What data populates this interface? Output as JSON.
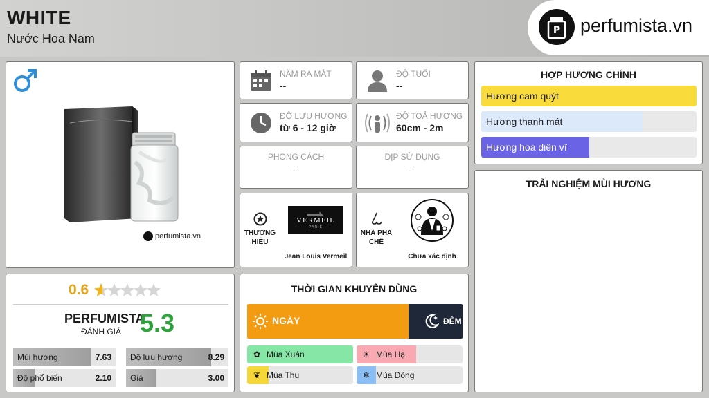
{
  "header": {
    "title": "WHITE",
    "subtitle": "Nước Hoa Nam",
    "logo_text": "perfumista.vn"
  },
  "product": {
    "gender_icon": "male-icon",
    "watermark": "perfumista.vn"
  },
  "info": {
    "release_year": {
      "label": "NĂM RA MẮT",
      "value": "--",
      "icon": "calendar-icon"
    },
    "age": {
      "label": "ĐỘ TUỔI",
      "value": "--",
      "icon": "person-icon"
    },
    "longevity": {
      "label": "ĐỘ LƯU HƯƠNG",
      "value": "từ 6 - 12 giờ",
      "icon": "clock-icon"
    },
    "sillage": {
      "label": "ĐỘ TOẢ HƯƠNG",
      "value": "60cm - 2m",
      "icon": "sillage-icon"
    },
    "style": {
      "label": "PHONG CÁCH",
      "value": "--"
    },
    "occasion": {
      "label": "DỊP SỬ DỤNG",
      "value": "--"
    }
  },
  "brand": {
    "label_line1": "THƯƠNG",
    "label_line2": "HIỆU",
    "name": "Jean Louis Vermeil",
    "logo_text": "VERMEIL",
    "logo_sub": "PARIS"
  },
  "perfumer": {
    "label_line1": "NHÀ PHA",
    "label_line2": "CHẾ",
    "name": "Chưa xác định"
  },
  "accords": {
    "title": "HỢP HƯƠNG CHÍNH",
    "items": [
      {
        "label": "Hương cam quýt",
        "level": 1.0,
        "color": "#f9dc3c"
      },
      {
        "label": "Hương thanh mát",
        "level": 0.75,
        "color": "#dbe9fb"
      },
      {
        "label": "Hương hoa diên vĩ",
        "level": 0.5,
        "color": "#6a63e6"
      }
    ]
  },
  "experience": {
    "title": "TRẢI NGHIỆM MÙI HƯƠNG"
  },
  "rating": {
    "score": "0.6",
    "stars_total": 5,
    "stars_filled": 0.6,
    "brand": "PERFUMISTA",
    "brand_sub": "ĐÁNH GIÁ",
    "overall": "5.3",
    "stats": [
      {
        "label": "Mùi hương",
        "value": "7.63",
        "level": 0.763
      },
      {
        "label": "Độ lưu hương",
        "value": "8.29",
        "level": 0.829
      },
      {
        "label": "Độ phổ biến",
        "value": "2.10",
        "level": 0.21
      },
      {
        "label": "Giá",
        "value": "3.00",
        "level": 0.3
      }
    ]
  },
  "time": {
    "title": "THỜI GIAN KHUYÊN DÙNG",
    "day_label": "NGÀY",
    "night_label": "ĐÊM",
    "day_share": 0.75,
    "day_color": "#f39c12",
    "night_color": "#1e2838",
    "seasons": [
      {
        "label": "Mùa Xuân",
        "level": 1.0,
        "color": "#86e6a6",
        "icon": "flower-icon"
      },
      {
        "label": "Mùa Hạ",
        "level": 0.56,
        "color": "#f9a9b1",
        "icon": "sun-icon"
      },
      {
        "label": "Mùa Thu",
        "level": 0.2,
        "color": "#f6d73a",
        "icon": "leaf-icon"
      },
      {
        "label": "Mùa Đông",
        "level": 0.18,
        "color": "#8bbef3",
        "icon": "snowflake-icon"
      }
    ]
  }
}
